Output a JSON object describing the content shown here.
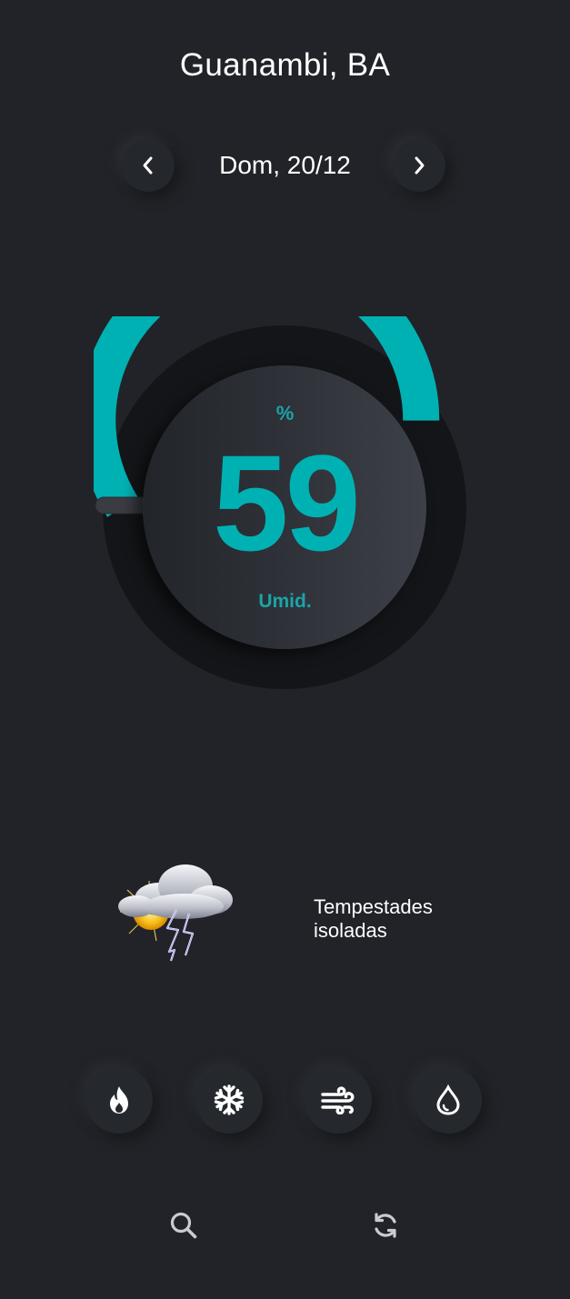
{
  "header": {
    "city": "Guanambi, BA"
  },
  "date_nav": {
    "date": "Dom, 20/12",
    "prev_icon": "chevron-left-icon",
    "next_icon": "chevron-right-icon"
  },
  "gauge": {
    "unit": "%",
    "value": "59",
    "label": "Umid.",
    "fraction": 0.59,
    "accent_color": "#00b1b3"
  },
  "weather": {
    "description": "Tempestades isoladas",
    "icon": "thunderstorm-partly-sunny-icon"
  },
  "metrics": [
    {
      "icon": "flame-icon",
      "name": "temperatura"
    },
    {
      "icon": "snowflake-icon",
      "name": "frio"
    },
    {
      "icon": "wind-icon",
      "name": "vento"
    },
    {
      "icon": "droplet-icon",
      "name": "umidade"
    }
  ],
  "toolbar": {
    "search_icon": "search-icon",
    "refresh_icon": "refresh-icon"
  },
  "colors": {
    "background": "#212328",
    "accent": "#00b1b3",
    "text": "#ffffff"
  }
}
